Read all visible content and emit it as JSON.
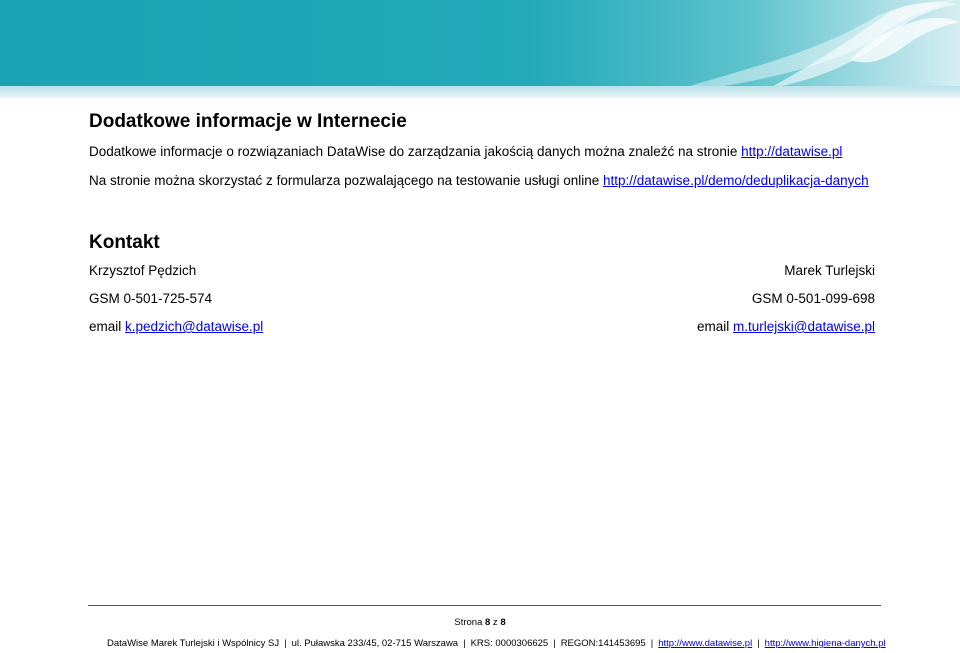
{
  "header": {
    "banner_colors": [
      "#1aa3b3",
      "#5ec3cd",
      "#d6eef2"
    ],
    "logo_icon": "seagull-icon"
  },
  "section_internet": {
    "heading": "Dodatkowe informacje w Internecie",
    "para1_text": "Dodatkowe informacje o rozwiązaniach DataWise do zarządzania jakością danych można znaleźć na stronie ",
    "para1_link": "http://datawise.pl",
    "para2_text": "Na stronie można skorzystać z formularza pozwalającego na testowanie usługi online ",
    "para2_link": "http://datawise.pl/demo/deduplikacja-danych"
  },
  "section_contact": {
    "heading": "Kontakt",
    "left": {
      "name": "Krzysztof Pędzich",
      "phone": "GSM 0-501-725-574",
      "email_prefix": "email ",
      "email": "k.pedzich@datawise.pl"
    },
    "right": {
      "name": "Marek Turlejski",
      "phone": "GSM 0-501-099-698",
      "email_prefix": "email ",
      "email": "m.turlejski@datawise.pl"
    }
  },
  "footer": {
    "page_prefix": "Strona ",
    "page_current": "8",
    "page_of": " z ",
    "page_total": "8",
    "company": "DataWise Marek Turlejski i Wspólnicy SJ",
    "address": "ul. Puławska 233/45, 02-715 Warszawa",
    "krs": "KRS: 0000306625",
    "regon": "REGON:141453695",
    "link1": "http://www.datawise.pl",
    "link2": "http://www.higiena-danych.pl",
    "separator": "|"
  }
}
